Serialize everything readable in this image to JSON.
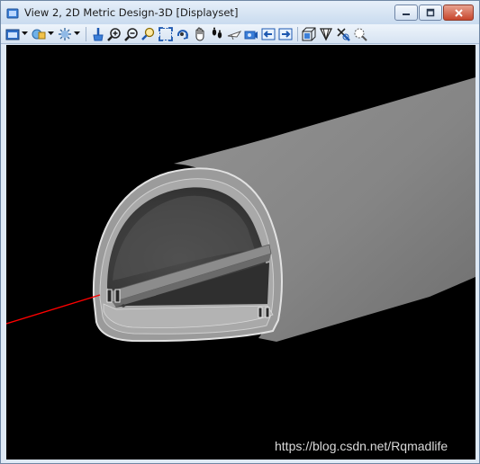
{
  "window": {
    "title": "View 2, 2D Metric Design-3D [Displayset]"
  },
  "toolbar": {
    "tools": [
      "view-attributes-icon",
      "dropdown-arrow-icon",
      "display-style-icon",
      "dropdown-arrow-icon",
      "render-icon",
      "dropdown-arrow-icon",
      "update-view-icon",
      "zoom-in-icon",
      "zoom-out-icon",
      "window-area-icon",
      "fit-view-icon",
      "rotate-view-icon",
      "pan-view-icon",
      "walk-icon",
      "fly-icon",
      "camera-icon",
      "previous-view-icon",
      "next-view-icon",
      "clip-volume-icon",
      "clip-mask-icon",
      "copy-view-icon",
      "view-settings-icon"
    ]
  },
  "watermark": {
    "text": "https://blog.csdn.net/Rqmadlife"
  },
  "colors": {
    "viewport_background": "#000000",
    "tunnel_outer": "#808080",
    "tunnel_lining": "#a8a8a8",
    "marker_line": "#ff0000"
  }
}
